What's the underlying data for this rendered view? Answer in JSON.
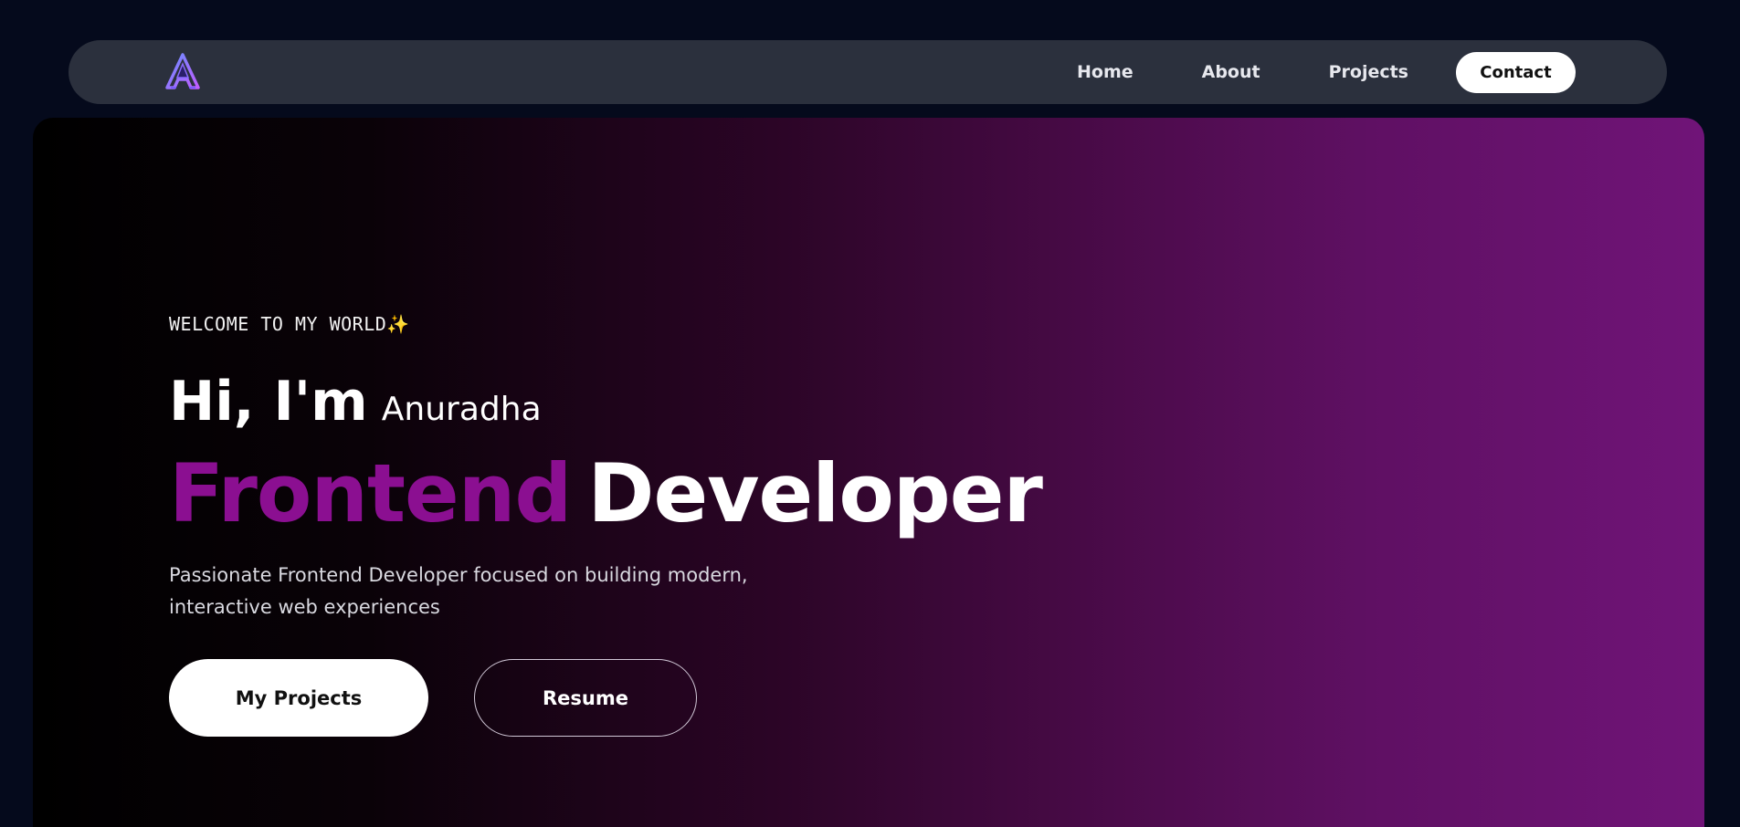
{
  "navbar": {
    "logo": {
      "icon": "letter-a-logo",
      "letter": "A"
    },
    "links": [
      {
        "label": "Home"
      },
      {
        "label": "About"
      },
      {
        "label": "Projects"
      }
    ],
    "contact_label": "Contact"
  },
  "hero": {
    "welcome": "WELCOME TO MY WORLD",
    "welcome_icon": "✨",
    "greeting": "Hi, I'm",
    "name": "Anuradha",
    "role": "Frontend",
    "title": "Developer",
    "tagline": "Passionate Frontend Developer focused on building modern, interactive web experiences",
    "primary_button": "My Projects",
    "secondary_button": "Resume"
  },
  "colors": {
    "page_background": "#050a1c",
    "navbar_background": "#2b303d",
    "accent_purple": "#8b0f91",
    "hero_gradient_end": "#701478"
  }
}
